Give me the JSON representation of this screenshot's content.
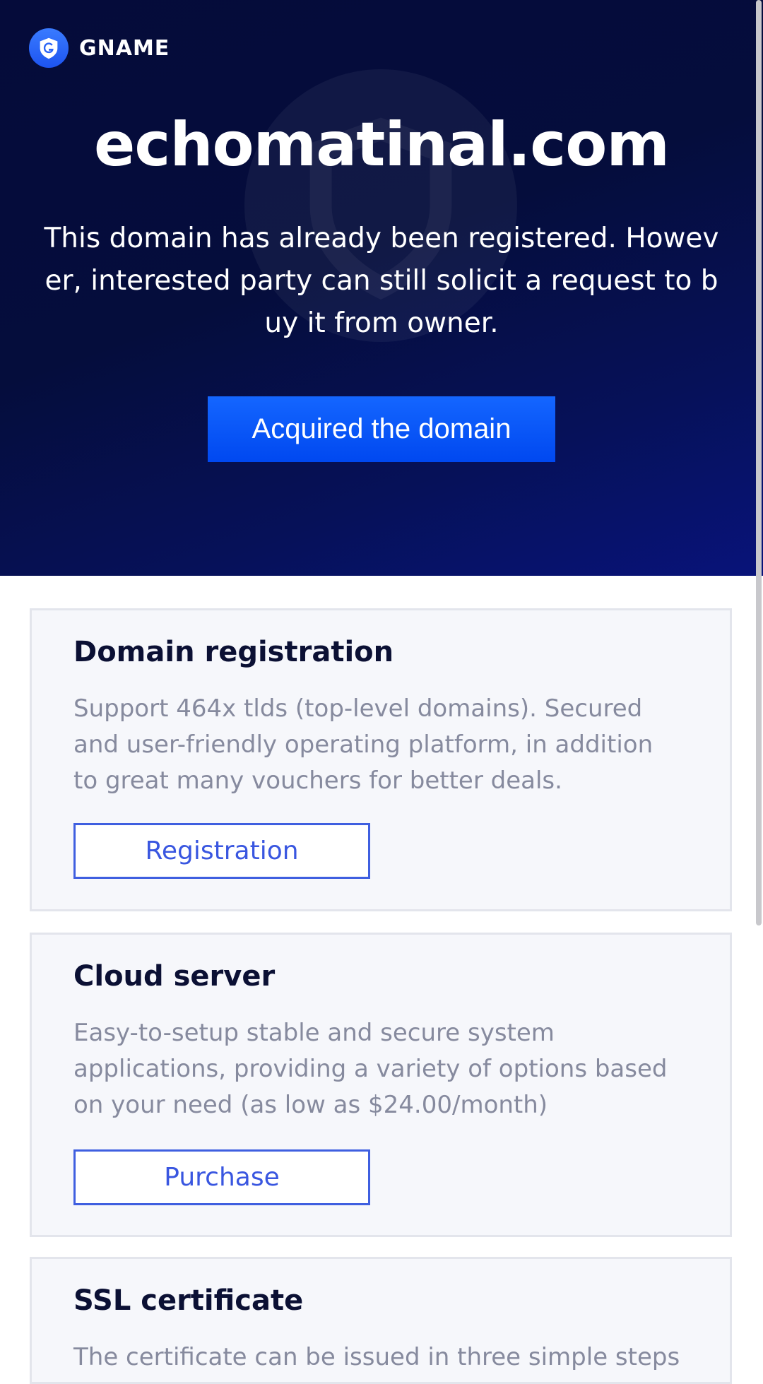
{
  "brand": {
    "name": "GNAME",
    "logo_icon": "g-shield-icon",
    "accent": "#1466ff"
  },
  "hero": {
    "domain": "echomatinal.com",
    "description": "This domain has already been registered. However, interested party can still solicit a request to buy it from owner.",
    "button_label": "Acquired the domain"
  },
  "cards": [
    {
      "title": "Domain registration",
      "description": "Support 464x tlds (top-level domains). Secured and user-friendly operating platform, in addition to great many vouchers for better deals.",
      "button_label": "Registration"
    },
    {
      "title": "Cloud server",
      "description": "Easy-to-setup stable and secure system applications, providing a variety of options based on your need (as low as $24.00/month)",
      "button_label": "Purchase"
    },
    {
      "title": "SSL certificate",
      "description": "The certificate can be issued in three simple steps"
    }
  ]
}
